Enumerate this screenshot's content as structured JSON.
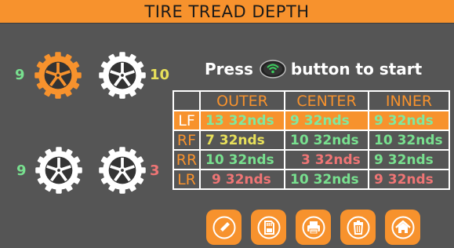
{
  "header": {
    "title": "TIRE TREAD DEPTH"
  },
  "tires": {
    "lf": {
      "value": "9"
    },
    "rf": {
      "value": "10"
    },
    "lr": {
      "value": "9"
    },
    "rr": {
      "value": "3"
    }
  },
  "prompt": {
    "before": "Press",
    "after": "button to start",
    "icon": "start-button-icon"
  },
  "table": {
    "headers": [
      "OUTER",
      "CENTER",
      "INNER"
    ],
    "rows": [
      {
        "label": "LF",
        "outer": "13  32nds",
        "center": "9  32nds",
        "inner": "9  32nds"
      },
      {
        "label": "RF",
        "outer": "7  32nds",
        "center": "10  32nds",
        "inner": "10  32nds"
      },
      {
        "label": "RR",
        "outer": "10  32nds",
        "center": "3  32nds",
        "inner": "9  32nds"
      },
      {
        "label": "LR",
        "outer": "9  32nds",
        "center": "10  32nds",
        "inner": "9  32nds"
      }
    ]
  },
  "toolbar": {
    "icons": [
      "pencil-icon",
      "sd-card-icon",
      "printer-icon",
      "trash-icon",
      "home-icon"
    ]
  },
  "colors": {
    "accent": "#f7922d",
    "background": "#555555",
    "good": "#78e08f",
    "warn": "#e8e05a",
    "bad": "#ef7575"
  }
}
